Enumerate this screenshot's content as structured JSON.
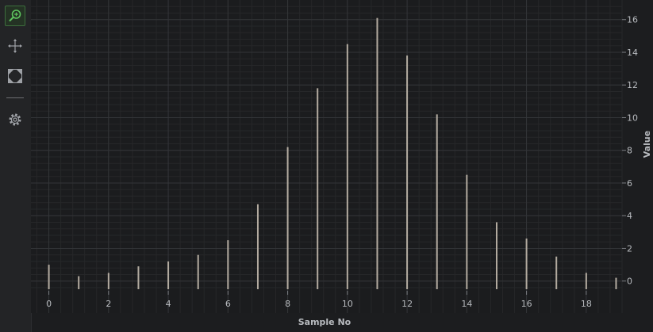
{
  "toolbar": {
    "items": [
      {
        "icon": "zoom-icon",
        "active": true
      },
      {
        "icon": "pan-icon",
        "active": false
      },
      {
        "icon": "zoom-extents-icon",
        "active": false
      },
      {
        "icon": "settings-gear-icon",
        "active": false
      }
    ]
  },
  "colors": {
    "background": "#1c1d1f",
    "grid_major": "#333538",
    "grid_minor": "#262729",
    "bar": "#b3aba0",
    "text": "#b8bbbf",
    "accent_active": "#5ec45e"
  },
  "chart_data": {
    "type": "bar",
    "x": [
      0,
      1,
      2,
      3,
      4,
      5,
      6,
      7,
      8,
      9,
      10,
      11,
      12,
      13,
      14,
      15,
      16,
      17,
      18,
      19
    ],
    "values": [
      1.0,
      0.3,
      0.5,
      0.9,
      1.2,
      1.6,
      2.5,
      4.7,
      8.2,
      11.8,
      14.5,
      16.1,
      13.8,
      10.2,
      6.5,
      3.6,
      2.6,
      1.5,
      0.5,
      0.2
    ],
    "xlabel": "Sample No",
    "ylabel": "Value",
    "xlim": [
      -0.6,
      19.2
    ],
    "ylim": [
      -0.5,
      17.2
    ],
    "xticks": [
      0,
      2,
      4,
      6,
      8,
      10,
      12,
      14,
      16,
      18
    ],
    "yticks": [
      0,
      2,
      4,
      6,
      8,
      10,
      12,
      14,
      16
    ],
    "grid": true,
    "y_axis_position": "right"
  }
}
